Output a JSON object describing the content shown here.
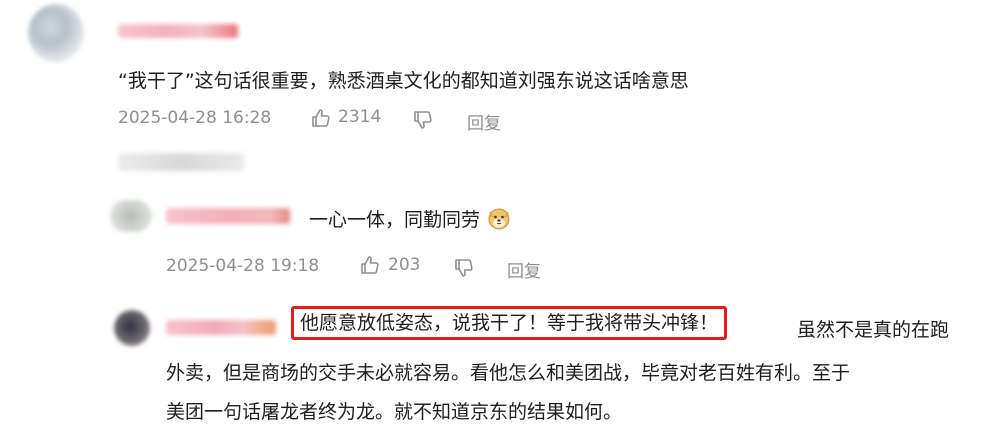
{
  "comments": [
    {
      "text": "“我干了”这句话很重要，熟悉酒桌文化的都知道刘强东说这话啥意思",
      "time": "2025-04-28 16:28",
      "likes": "2314",
      "reply_label": "回复"
    },
    {
      "text": "一心一体，同勤同劳",
      "emoji": "dog-emoji",
      "time": "2025-04-28 19:18",
      "likes": "203",
      "reply_label": "回复"
    },
    {
      "highlight_text": "他愿意放低姿态，说我干了！等于我将带头冲锋！",
      "line1_rest": "虽然不是真的在跑",
      "line2": "外卖，但是商场的交手未必就容易。看他怎么和美团战，毕竟对老百姓有利。至于",
      "line3": "美团一句话屠龙者终为龙。就不知道京东的结果如何。"
    }
  ],
  "icons": {
    "like": "thumbs-up-icon",
    "dislike": "thumbs-down-icon"
  },
  "colors": {
    "highlight_border": "#e41b1b",
    "meta_text": "#8f8f8f"
  }
}
